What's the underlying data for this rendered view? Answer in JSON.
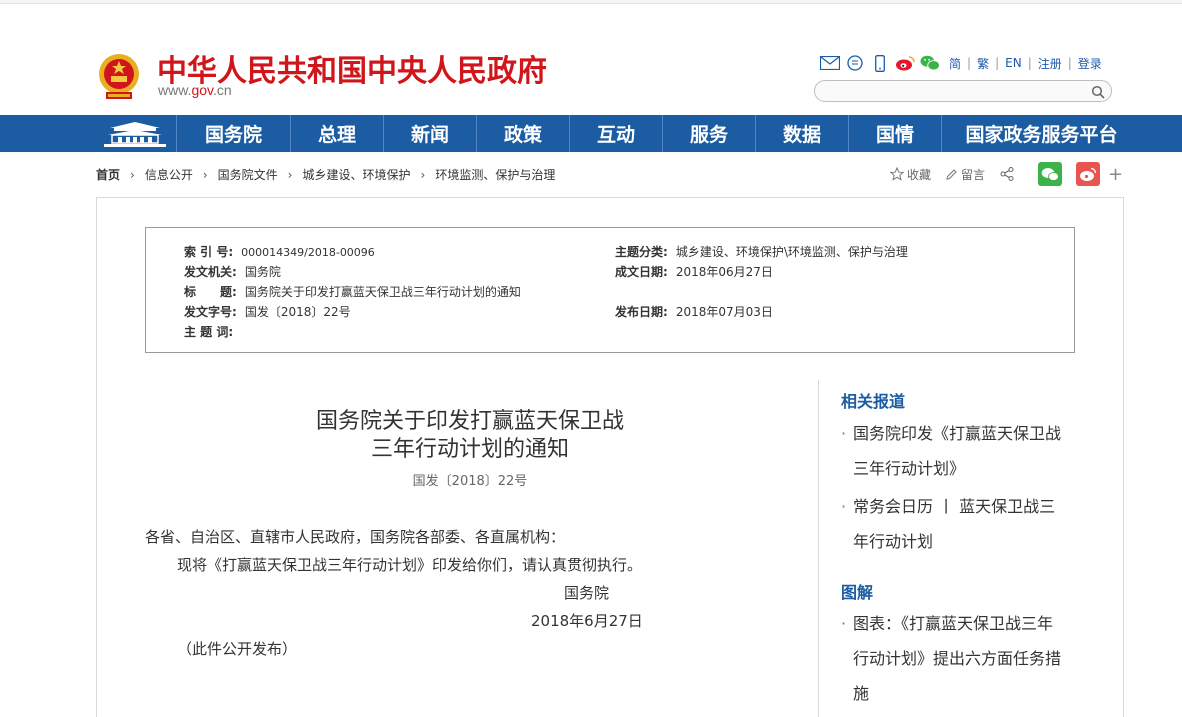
{
  "header": {
    "site_title": "中华人民共和国中央人民政府",
    "domain_prefix": "www.",
    "domain_red": "gov",
    "domain_suffix": ".cn",
    "links": [
      "简",
      "繁",
      "EN",
      "注册",
      "登录"
    ],
    "icons": [
      "mail-icon",
      "comment-icon",
      "mobile-icon",
      "weibo-icon",
      "wechat-icon"
    ],
    "search_placeholder": ""
  },
  "nav": {
    "items": [
      "国务院",
      "总理",
      "新闻",
      "政策",
      "互动",
      "服务",
      "数据",
      "国情",
      "国家政务服务平台"
    ]
  },
  "breadcrumb": [
    "首页",
    "信息公开",
    "国务院文件",
    "城乡建设、环境保护",
    "环境监测、保护与治理"
  ],
  "actions": {
    "favorite": "收藏",
    "comment": "留言"
  },
  "meta": {
    "index_label": "索 引 号:",
    "index_value": "000014349/2018-00096",
    "topic_label": "主题分类:",
    "topic_value": "城乡建设、环境保护\\环境监测、保护与治理",
    "issuer_label": "发文机关:",
    "issuer_value": "国务院",
    "created_label": "成文日期:",
    "created_value": "2018年06月27日",
    "title_label": "标　　题:",
    "title_value": "国务院关于印发打赢蓝天保卫战三年行动计划的通知",
    "docno_label": "发文字号:",
    "docno_value": "国发〔2018〕22号",
    "published_label": "发布日期:",
    "published_value": "2018年07月03日",
    "keywords_label": "主 题 词:",
    "keywords_value": ""
  },
  "article": {
    "title_line1": "国务院关于印发打赢蓝天保卫战",
    "title_line2": "三年行动计划的通知",
    "doc_number": "国发〔2018〕22号",
    "addressee": "各省、自治区、直辖市人民政府，国务院各部委、各直属机构：",
    "body": "现将《打赢蓝天保卫战三年行动计划》印发给你们，请认真贯彻执行。",
    "signature": "国务院",
    "date": "2018年6月27日",
    "note": "（此件公开发布）"
  },
  "sidebar": {
    "related_heading": "相关报道",
    "related": [
      {
        "line1": "国务院印发《打赢蓝天保卫战",
        "line2": "三年行动计划》"
      },
      {
        "line1": "常务会日历 丨 蓝天保卫战三",
        "line2": "年行动计划"
      }
    ],
    "graphic_heading": "图解",
    "graphics": [
      {
        "line1": "图表：《打赢蓝天保卫战三年",
        "line2": "行动计划》提出六方面任务措",
        "line3": "施"
      }
    ]
  },
  "colors": {
    "brand_red": "#d0161b",
    "nav_blue": "#1b5ca3"
  }
}
